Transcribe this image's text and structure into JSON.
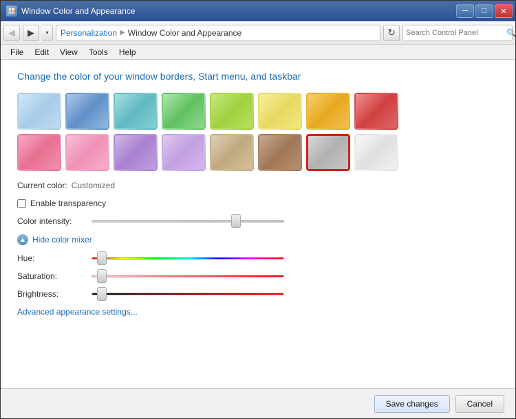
{
  "window": {
    "title": "Window Color and Appearance",
    "icon": "🪟"
  },
  "titlebar": {
    "minimize_label": "─",
    "maximize_label": "□",
    "close_label": "✕"
  },
  "navbar": {
    "back_label": "◀",
    "forward_label": "▶",
    "dropdown_label": "▾",
    "refresh_label": "↻",
    "breadcrumb": {
      "part1": "Personalization",
      "separator": "▶",
      "part2": "Window Color and Appearance"
    },
    "search_placeholder": "Search Control Panel"
  },
  "menubar": {
    "items": [
      "File",
      "Edit",
      "View",
      "Tools",
      "Help"
    ]
  },
  "content": {
    "page_title": "Change the color of your window borders, Start menu, and taskbar",
    "current_color_label": "Current color:",
    "current_color_value": "Customized",
    "transparency_label": "Enable transparency",
    "intensity_label": "Color intensity:",
    "toggle_label": "Hide color mixer",
    "hue_label": "Hue:",
    "saturation_label": "Saturation:",
    "brightness_label": "Brightness:",
    "advanced_link": "Advanced appearance settings...",
    "swatches_row1": [
      {
        "name": "sky",
        "class": "swatch-sky",
        "selected": false
      },
      {
        "name": "blue",
        "class": "swatch-blue",
        "selected": false
      },
      {
        "name": "teal",
        "class": "swatch-teal",
        "selected": false
      },
      {
        "name": "green-light",
        "class": "swatch-green-light",
        "selected": false
      },
      {
        "name": "lime",
        "class": "swatch-lime",
        "selected": false
      },
      {
        "name": "yellow",
        "class": "swatch-yellow",
        "selected": false
      },
      {
        "name": "orange",
        "class": "swatch-orange",
        "selected": false
      },
      {
        "name": "red",
        "class": "swatch-red",
        "selected": false
      }
    ],
    "swatches_row2": [
      {
        "name": "pink",
        "class": "swatch-pink",
        "selected": false
      },
      {
        "name": "pink-light",
        "class": "swatch-pink-light",
        "selected": false
      },
      {
        "name": "lavender",
        "class": "swatch-lavender",
        "selected": false
      },
      {
        "name": "purple-light",
        "class": "swatch-purple-light",
        "selected": false
      },
      {
        "name": "tan",
        "class": "swatch-tan",
        "selected": false
      },
      {
        "name": "brown",
        "class": "swatch-brown",
        "selected": false
      },
      {
        "name": "silver",
        "class": "swatch-silver",
        "selected": true
      },
      {
        "name": "white",
        "class": "swatch-white",
        "selected": false
      }
    ],
    "sliders": {
      "intensity_value": 75,
      "hue_value": 5,
      "saturation_value": 5,
      "brightness_value": 5
    }
  },
  "footer": {
    "save_label": "Save changes",
    "cancel_label": "Cancel"
  }
}
